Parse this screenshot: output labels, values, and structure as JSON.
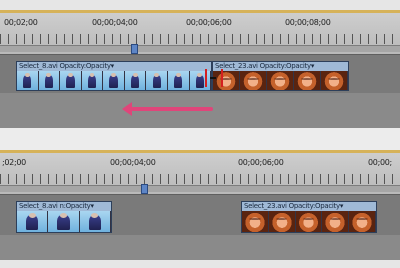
{
  "top_panel": {
    "ruler_labels": [
      "00;02;00",
      "00;00;04;00",
      "00;00;06;00",
      "00;00;08;00"
    ],
    "clips": [
      {
        "header": "Select_8.avi Opacity:Opacity▾",
        "frame_style": "blue",
        "frames": 9
      },
      {
        "header": "Select_23.avi Opacity:Opacity▾",
        "frame_style": "orange",
        "frames": 5
      }
    ]
  },
  "bottom_panel": {
    "ruler_labels": [
      ";02;00",
      "00;00;04;00",
      "00;00;06;00",
      "00;00;"
    ],
    "clips": [
      {
        "header": "Select_8.avi n:Opacity▾",
        "frame_style": "blue",
        "frames": 3
      },
      {
        "header": "Select_23.avi Opacity:Opacity▾",
        "frame_style": "orange",
        "frames": 5
      }
    ]
  }
}
